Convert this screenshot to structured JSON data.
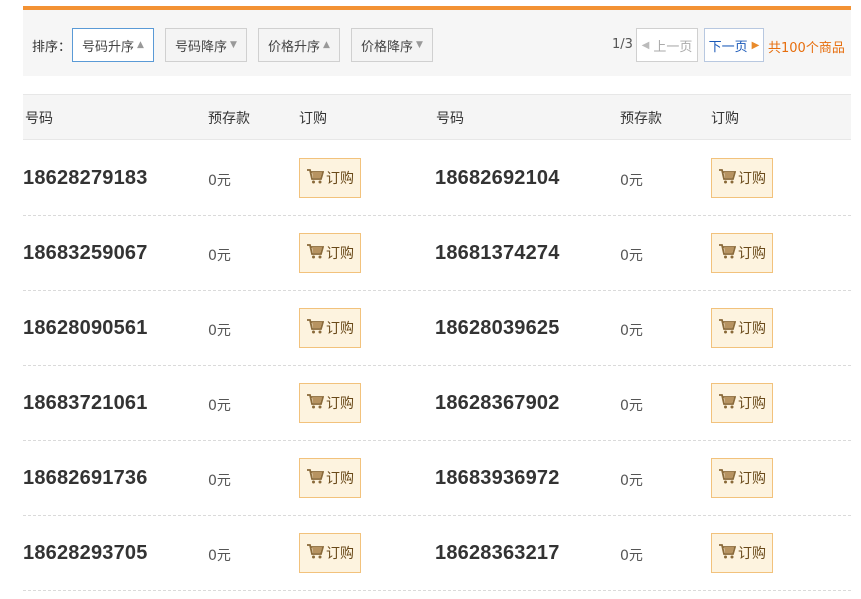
{
  "sort": {
    "label": "排序：",
    "buttons": [
      {
        "label": "号码升序"
      },
      {
        "label": "号码降序"
      },
      {
        "label": "价格升序"
      },
      {
        "label": "价格降序"
      }
    ]
  },
  "pager": {
    "page_info": "1/3",
    "prev_label": "上一页",
    "next_label": "下一页",
    "total": "共100个商品"
  },
  "columns": [
    "号码",
    "预存款",
    "订购",
    "号码",
    "预存款",
    "订购"
  ],
  "order_label": "订购",
  "rows": [
    {
      "left": {
        "number": "18628279183",
        "price": "0元"
      },
      "right": {
        "number": "18682692104",
        "price": "0元"
      }
    },
    {
      "left": {
        "number": "18683259067",
        "price": "0元"
      },
      "right": {
        "number": "18681374274",
        "price": "0元"
      }
    },
    {
      "left": {
        "number": "18628090561",
        "price": "0元"
      },
      "right": {
        "number": "18628039625",
        "price": "0元"
      }
    },
    {
      "left": {
        "number": "18683721061",
        "price": "0元"
      },
      "right": {
        "number": "18628367902",
        "price": "0元"
      }
    },
    {
      "left": {
        "number": "18682691736",
        "price": "0元"
      },
      "right": {
        "number": "18683936972",
        "price": "0元"
      }
    },
    {
      "left": {
        "number": "18628293705",
        "price": "0元"
      },
      "right": {
        "number": "18628363217",
        "price": "0元"
      }
    }
  ]
}
